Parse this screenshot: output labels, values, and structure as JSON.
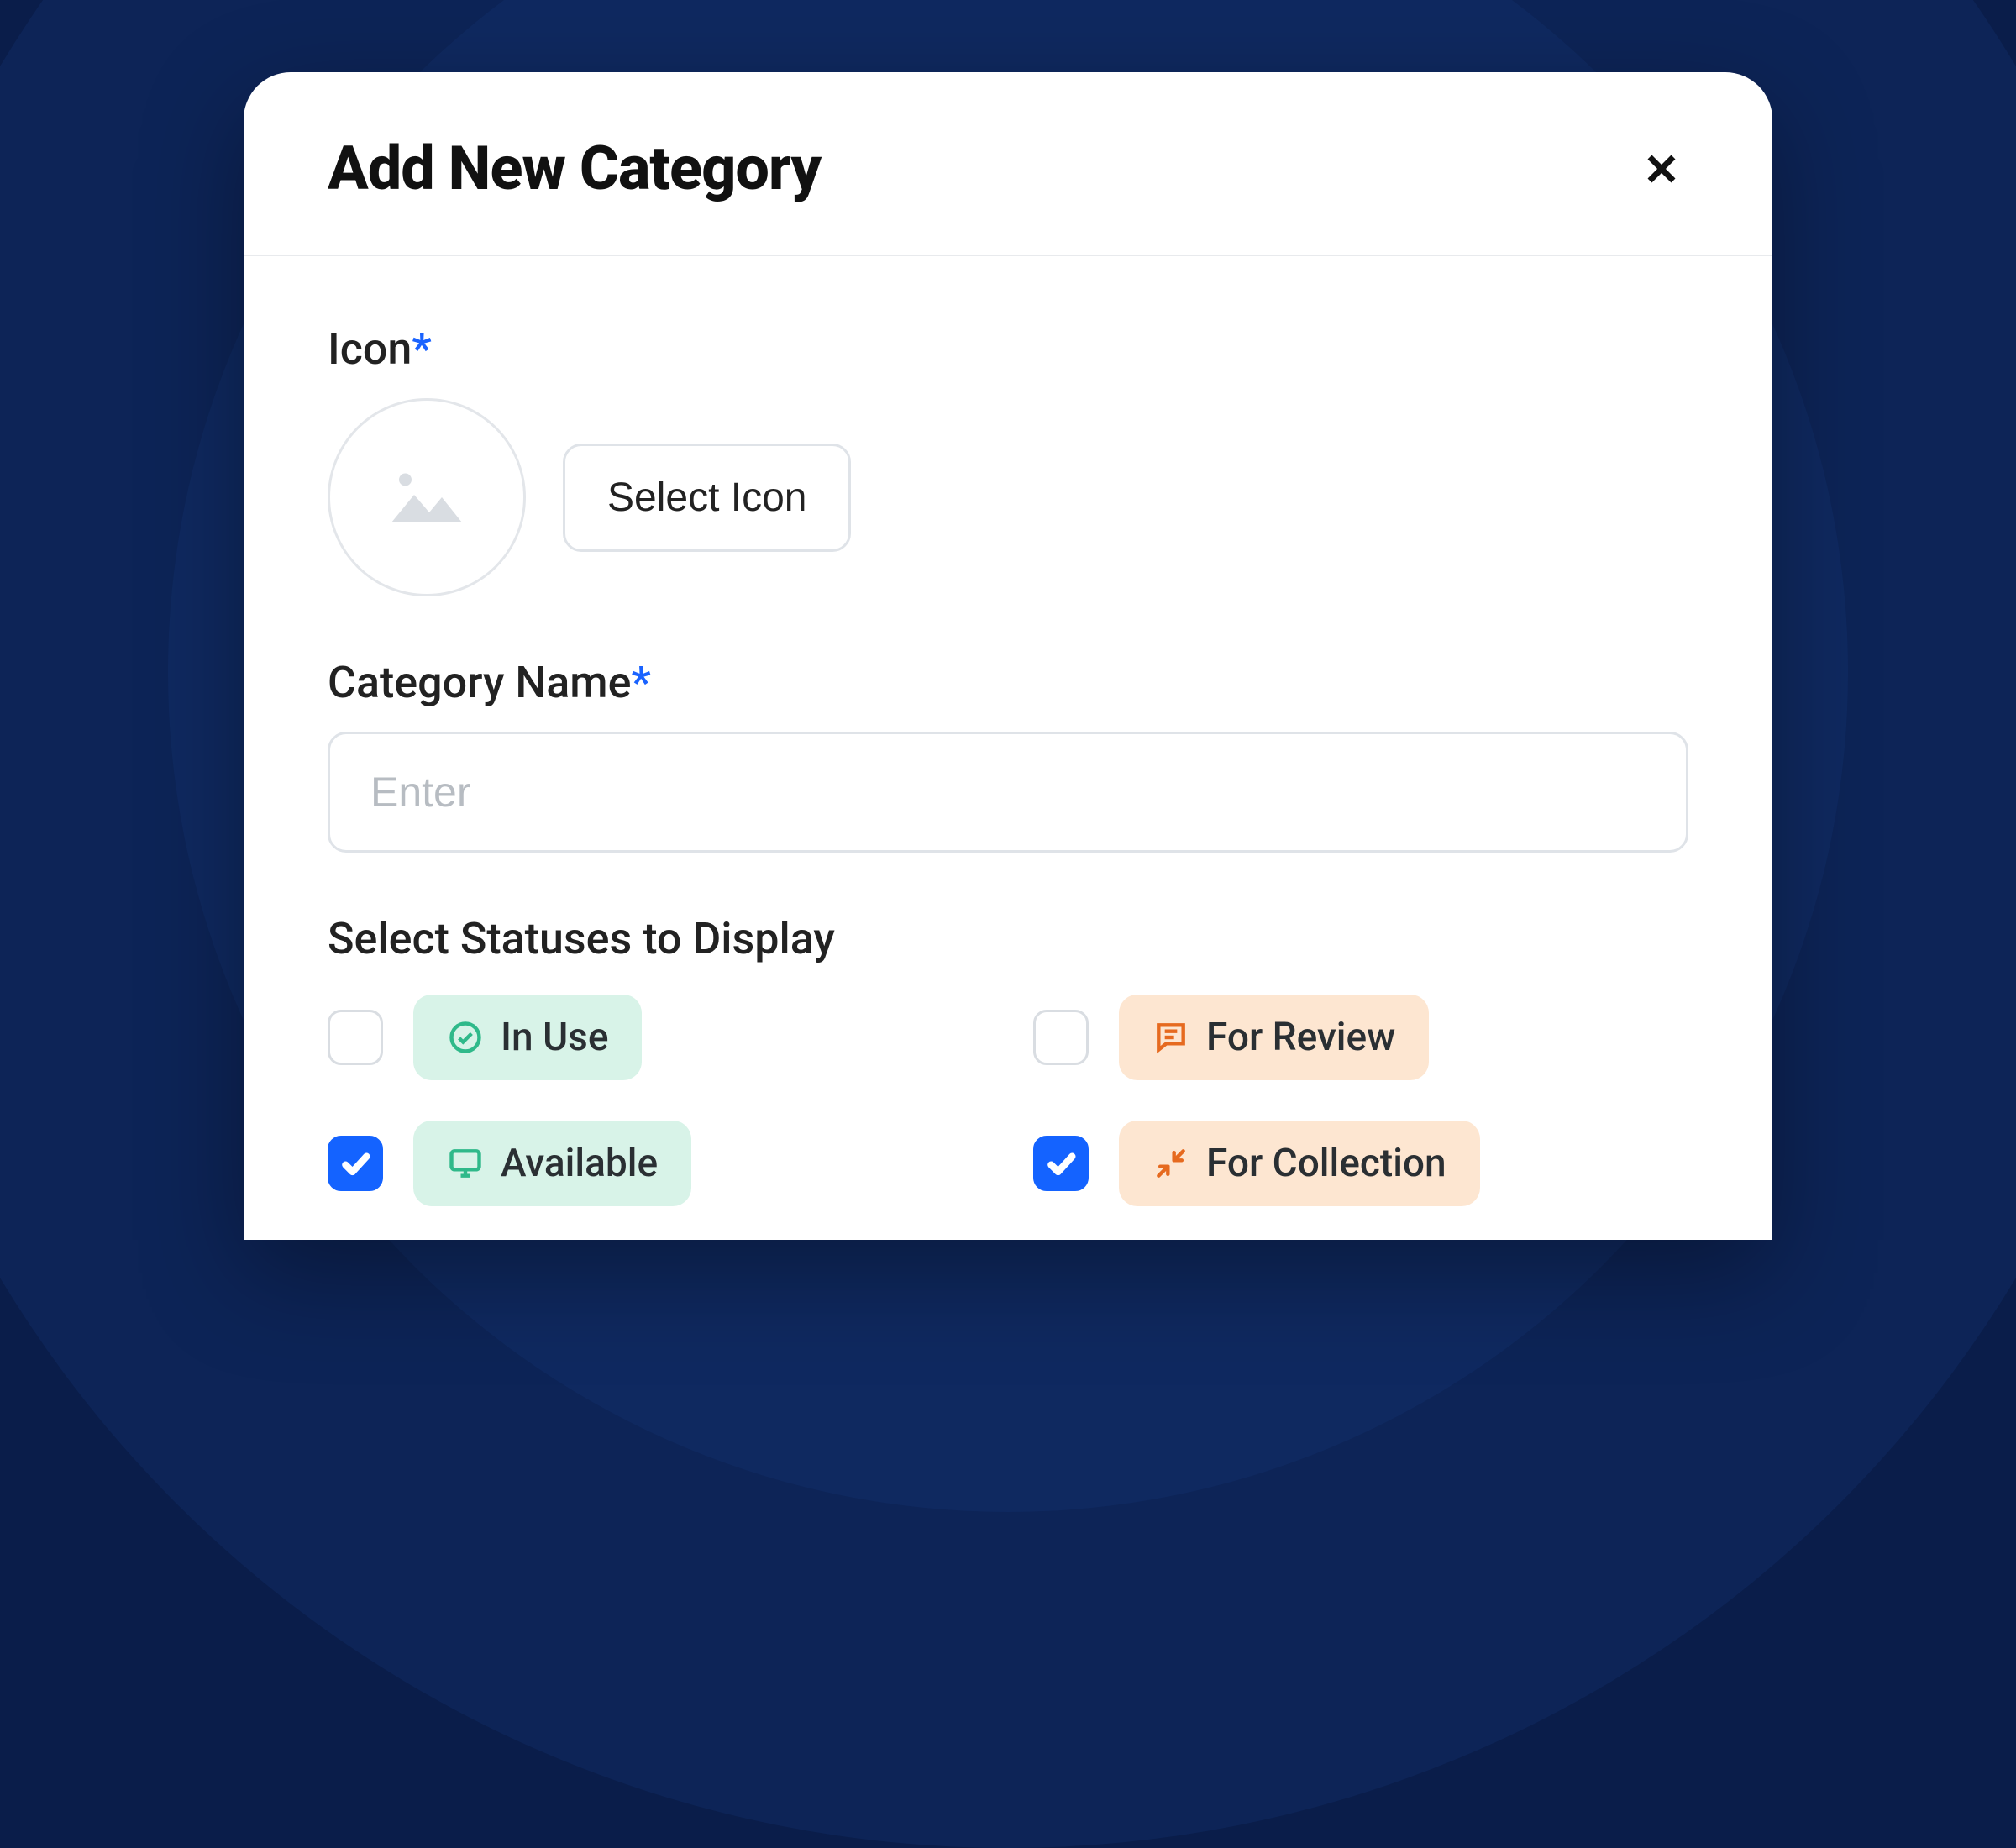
{
  "modal": {
    "title": "Add New Category",
    "required_marker": "*"
  },
  "fields": {
    "icon": {
      "label": "Icon",
      "button": "Select Icon"
    },
    "name": {
      "label": "Category Name",
      "placeholder": "Enter",
      "value": ""
    }
  },
  "statuses": {
    "label": "Select Statuses to Display",
    "items": [
      {
        "label": "In Use",
        "checked": false,
        "palette": "teal",
        "icon": "check-circle-icon"
      },
      {
        "label": "For Review",
        "checked": false,
        "palette": "orange",
        "icon": "message-icon"
      },
      {
        "label": "Available",
        "checked": true,
        "palette": "teal",
        "icon": "monitor-icon"
      },
      {
        "label": "For Collection",
        "checked": true,
        "palette": "orange",
        "icon": "arrows-in-icon"
      }
    ]
  },
  "colors": {
    "accent": "#1463ff",
    "teal_bg": "#d8f3e8",
    "teal_fg": "#2fb98a",
    "orange_bg": "#fde6d1",
    "orange_fg": "#e66a1f"
  }
}
